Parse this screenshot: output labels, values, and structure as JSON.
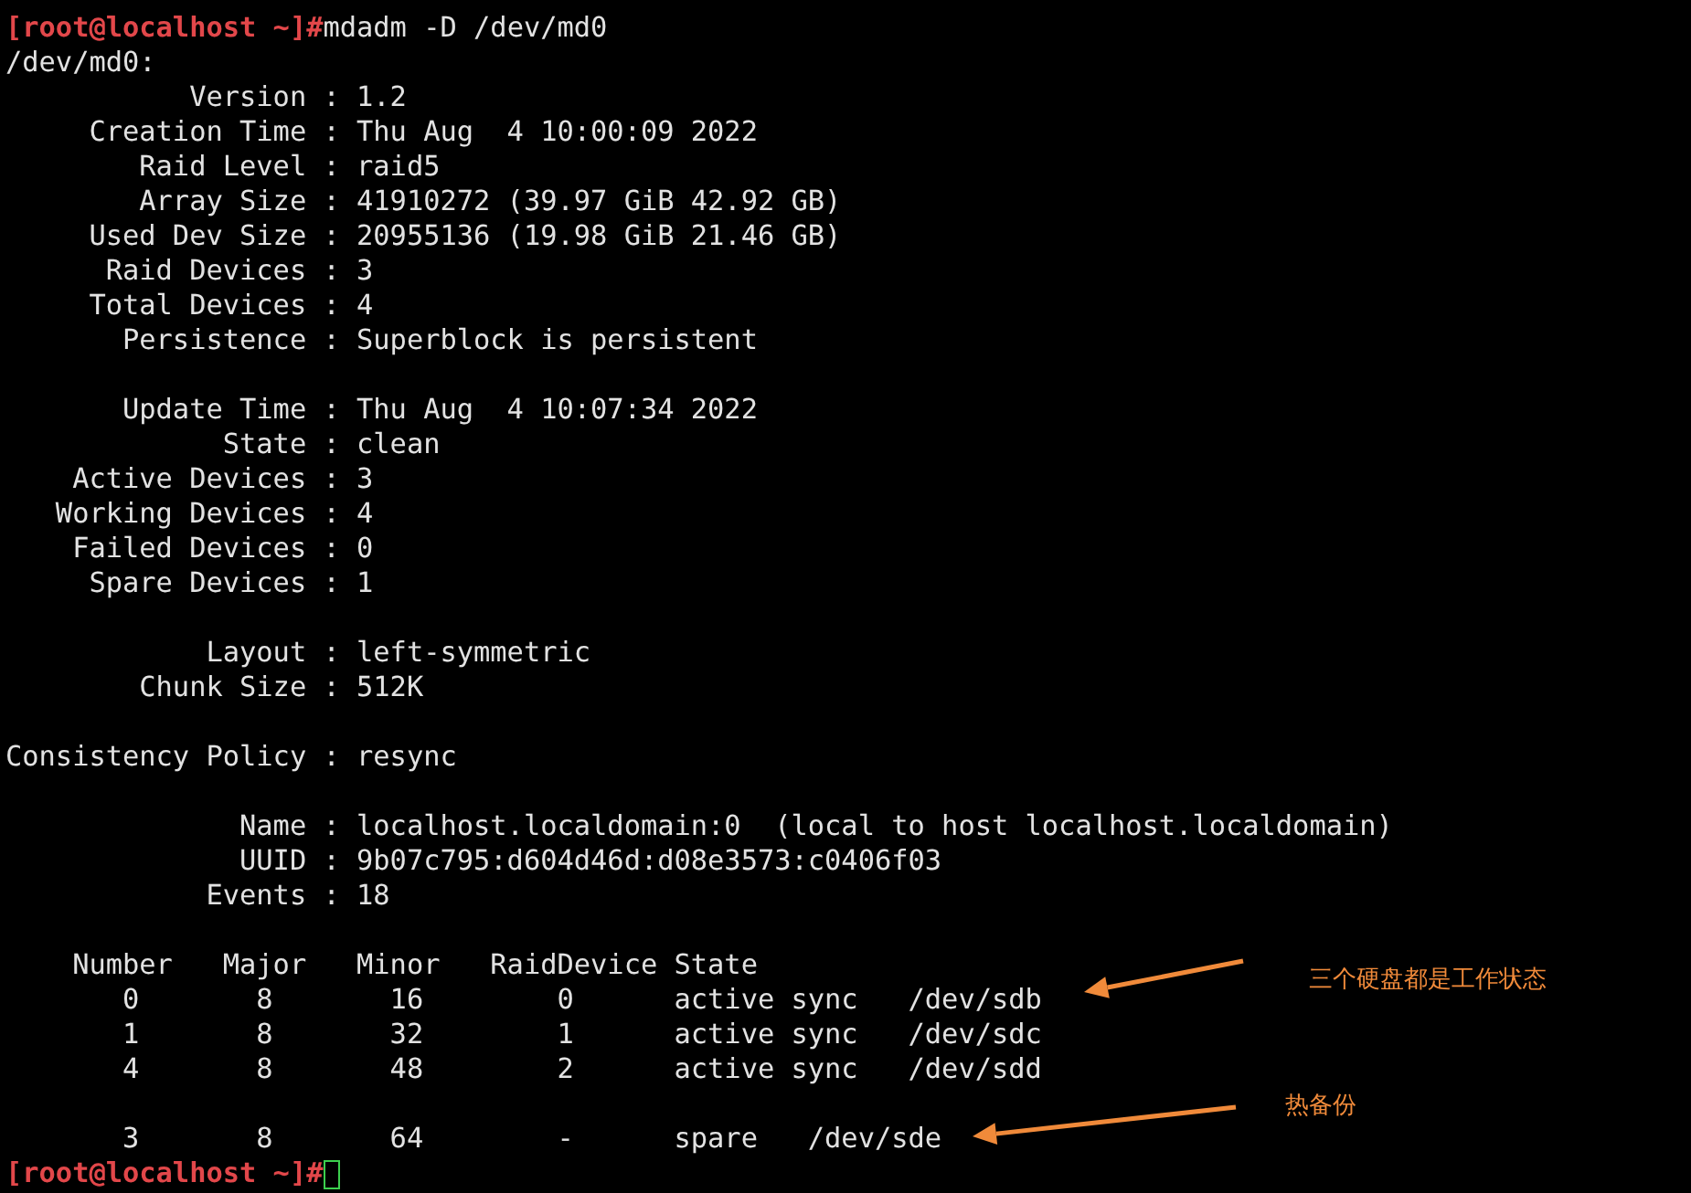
{
  "terminal": {
    "lines": [
      {
        "kind": "prompt",
        "prompt": "[root@localhost ~]#",
        "command": "mdadm -D /dev/md0"
      },
      {
        "kind": "output",
        "text": "/dev/md0:"
      },
      {
        "kind": "output",
        "text": "           Version : 1.2"
      },
      {
        "kind": "output",
        "text": "     Creation Time : Thu Aug  4 10:00:09 2022"
      },
      {
        "kind": "output",
        "text": "        Raid Level : raid5"
      },
      {
        "kind": "output",
        "text": "        Array Size : 41910272 (39.97 GiB 42.92 GB)"
      },
      {
        "kind": "output",
        "text": "     Used Dev Size : 20955136 (19.98 GiB 21.46 GB)"
      },
      {
        "kind": "output",
        "text": "      Raid Devices : 3"
      },
      {
        "kind": "output",
        "text": "     Total Devices : 4"
      },
      {
        "kind": "output",
        "text": "       Persistence : Superblock is persistent"
      },
      {
        "kind": "blank"
      },
      {
        "kind": "output",
        "text": "       Update Time : Thu Aug  4 10:07:34 2022"
      },
      {
        "kind": "output",
        "text": "             State : clean"
      },
      {
        "kind": "output",
        "text": "    Active Devices : 3"
      },
      {
        "kind": "output",
        "text": "   Working Devices : 4"
      },
      {
        "kind": "output",
        "text": "    Failed Devices : 0"
      },
      {
        "kind": "output",
        "text": "     Spare Devices : 1"
      },
      {
        "kind": "blank"
      },
      {
        "kind": "output",
        "text": "            Layout : left-symmetric"
      },
      {
        "kind": "output",
        "text": "        Chunk Size : 512K"
      },
      {
        "kind": "blank"
      },
      {
        "kind": "output",
        "text": "Consistency Policy : resync"
      },
      {
        "kind": "blank"
      },
      {
        "kind": "output",
        "text": "              Name : localhost.localdomain:0  (local to host localhost.localdomain)"
      },
      {
        "kind": "output",
        "text": "              UUID : 9b07c795:d604d46d:d08e3573:c0406f03"
      },
      {
        "kind": "output",
        "text": "            Events : 18"
      },
      {
        "kind": "blank"
      },
      {
        "kind": "output",
        "text": "    Number   Major   Minor   RaidDevice State"
      },
      {
        "kind": "output",
        "text": "       0       8       16        0      active sync   /dev/sdb"
      },
      {
        "kind": "output",
        "text": "       1       8       32        1      active sync   /dev/sdc"
      },
      {
        "kind": "output",
        "text": "       4       8       48        2      active sync   /dev/sdd"
      },
      {
        "kind": "blank"
      },
      {
        "kind": "output",
        "text": "       3       8       64        -      spare   /dev/sde"
      },
      {
        "kind": "prompt",
        "prompt": "[root@localhost ~]#",
        "cursor": true
      }
    ]
  },
  "annotations": [
    {
      "text": "三个硬盘都是工作状态"
    },
    {
      "text": "热备份"
    }
  ]
}
